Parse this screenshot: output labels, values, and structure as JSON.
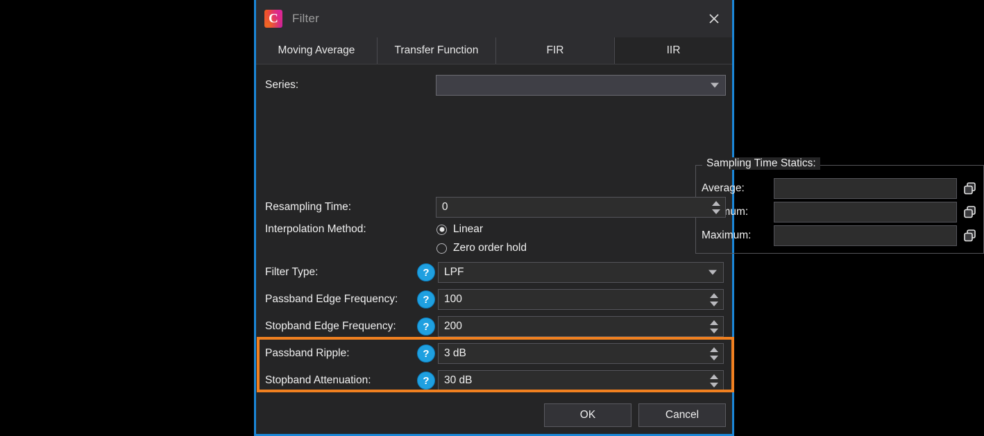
{
  "window": {
    "title": "Filter",
    "app_icon": "app-logo-c-icon",
    "close_icon": "close-icon",
    "border_color": "#1b87d8",
    "background": "#252526"
  },
  "tabs": [
    {
      "label": "Moving Average",
      "active": false
    },
    {
      "label": "Transfer Function",
      "active": false
    },
    {
      "label": "FIR",
      "active": false
    },
    {
      "label": "IIR",
      "active": true
    }
  ],
  "form": {
    "series": {
      "label": "Series:",
      "value": "",
      "placeholder": "",
      "dropdown_icon": "chevron-down-icon"
    },
    "sampling_group": {
      "title": "Sampling Time Statics:",
      "rows": [
        {
          "label": "Average:",
          "value": "",
          "copy_icon": "copy-icon"
        },
        {
          "label": "Minimum:",
          "value": "",
          "copy_icon": "copy-icon"
        },
        {
          "label": "Maximum:",
          "value": "",
          "copy_icon": "copy-icon"
        }
      ]
    },
    "resampling_time": {
      "label": "Resampling Time:",
      "value": "0",
      "spinner_up_icon": "spinner-up-icon",
      "spinner_down_icon": "spinner-down-icon"
    },
    "interpolation_method": {
      "label": "Interpolation Method:",
      "options": [
        {
          "label": "Linear",
          "selected": true
        },
        {
          "label": "Zero order hold",
          "selected": false
        }
      ]
    },
    "filter_type": {
      "label": "Filter Type:",
      "help_icon": "help-icon",
      "value": "LPF",
      "dropdown_icon": "chevron-down-icon"
    },
    "passband_edge_frequency": {
      "label": "Passband Edge Frequency:",
      "help_icon": "help-icon",
      "value": "100"
    },
    "stopband_edge_frequency": {
      "label": "Stopband Edge Frequency:",
      "help_icon": "help-icon",
      "value": "200"
    },
    "passband_ripple": {
      "label": "Passband Ripple:",
      "help_icon": "help-icon",
      "value": "3 dB"
    },
    "stopband_attenuation": {
      "label": "Stopband Attenuation:",
      "help_icon": "help-icon",
      "value": "30 dB"
    }
  },
  "footer": {
    "ok_label": "OK",
    "cancel_label": "Cancel"
  },
  "annotation": {
    "highlight_color": "#f08020",
    "highlights": [
      "Passband Ripple:",
      "Stopband Attenuation:"
    ]
  },
  "glyphs": {
    "help": "?"
  }
}
